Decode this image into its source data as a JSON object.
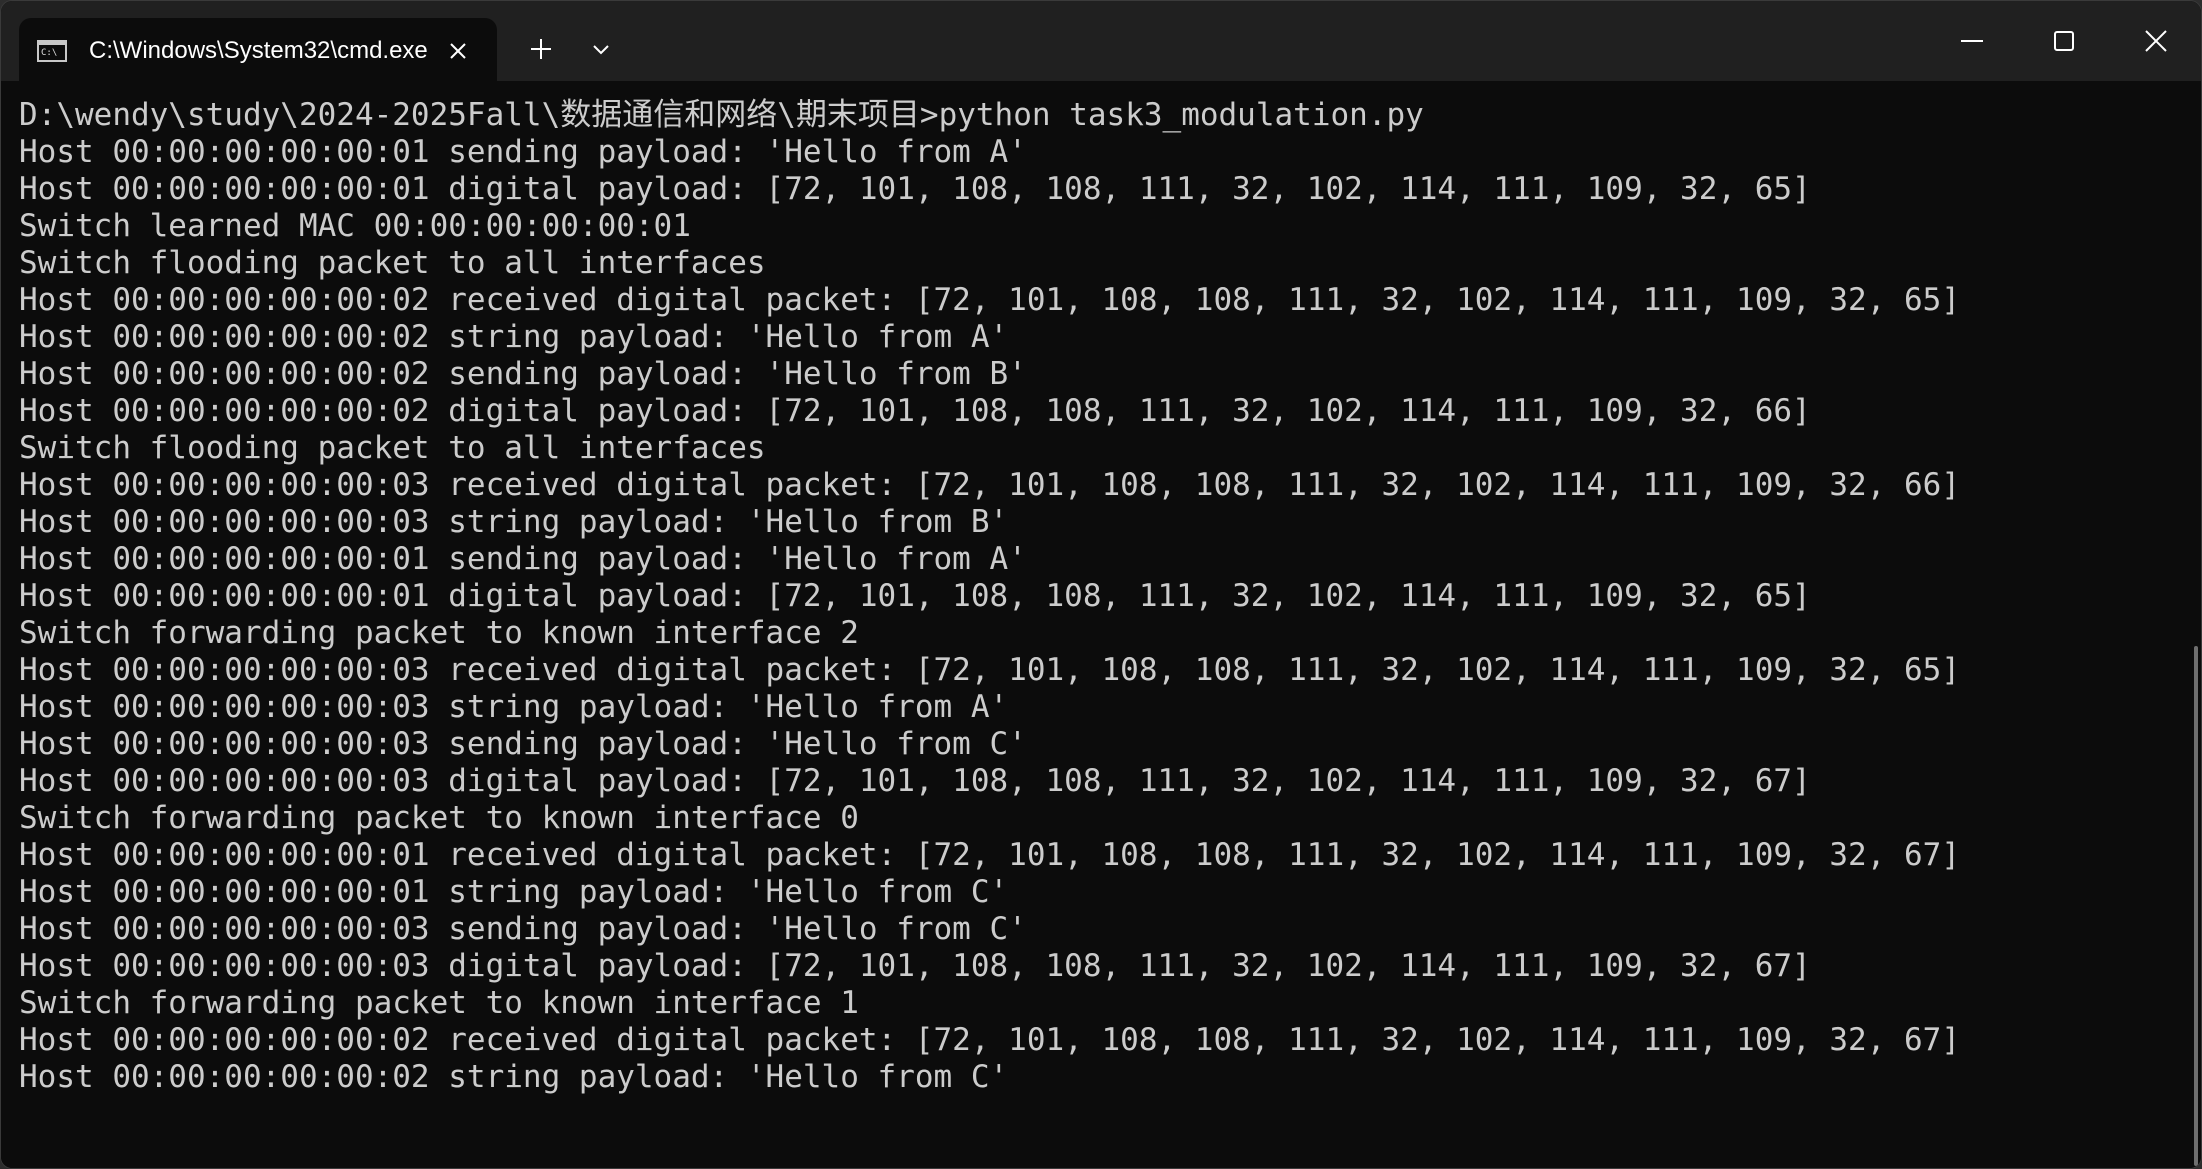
{
  "window": {
    "tab_title": "C:\\Windows\\System32\\cmd.exe",
    "tab_icon": "cmd-terminal-icon",
    "buttons": {
      "new_tab_icon": "plus-icon",
      "dropdown_icon": "chevron-down-icon",
      "minimize_icon": "minimize-icon",
      "maximize_icon": "maximize-icon",
      "close_icon": "close-icon"
    },
    "colors": {
      "titlebar": "#202020",
      "background": "#0c0c0c",
      "text": "#cccccc"
    }
  },
  "terminal": {
    "lines": [
      "D:\\wendy\\study\\2024-2025Fall\\数据通信和网络\\期末项目>python task3_modulation.py",
      "Host 00:00:00:00:00:01 sending payload: 'Hello from A'",
      "Host 00:00:00:00:00:01 digital payload: [72, 101, 108, 108, 111, 32, 102, 114, 111, 109, 32, 65]",
      "Switch learned MAC 00:00:00:00:00:01",
      "Switch flooding packet to all interfaces",
      "Host 00:00:00:00:00:02 received digital packet: [72, 101, 108, 108, 111, 32, 102, 114, 111, 109, 32, 65]",
      "Host 00:00:00:00:00:02 string payload: 'Hello from A'",
      "Host 00:00:00:00:00:02 sending payload: 'Hello from B'",
      "Host 00:00:00:00:00:02 digital payload: [72, 101, 108, 108, 111, 32, 102, 114, 111, 109, 32, 66]",
      "Switch flooding packet to all interfaces",
      "Host 00:00:00:00:00:03 received digital packet: [72, 101, 108, 108, 111, 32, 102, 114, 111, 109, 32, 66]",
      "Host 00:00:00:00:00:03 string payload: 'Hello from B'",
      "Host 00:00:00:00:00:01 sending payload: 'Hello from A'",
      "Host 00:00:00:00:00:01 digital payload: [72, 101, 108, 108, 111, 32, 102, 114, 111, 109, 32, 65]",
      "Switch forwarding packet to known interface 2",
      "Host 00:00:00:00:00:03 received digital packet: [72, 101, 108, 108, 111, 32, 102, 114, 111, 109, 32, 65]",
      "Host 00:00:00:00:00:03 string payload: 'Hello from A'",
      "Host 00:00:00:00:00:03 sending payload: 'Hello from C'",
      "Host 00:00:00:00:00:03 digital payload: [72, 101, 108, 108, 111, 32, 102, 114, 111, 109, 32, 67]",
      "Switch forwarding packet to known interface 0",
      "Host 00:00:00:00:00:01 received digital packet: [72, 101, 108, 108, 111, 32, 102, 114, 111, 109, 32, 67]",
      "Host 00:00:00:00:00:01 string payload: 'Hello from C'",
      "Host 00:00:00:00:00:03 sending payload: 'Hello from C'",
      "Host 00:00:00:00:00:03 digital payload: [72, 101, 108, 108, 111, 32, 102, 114, 111, 109, 32, 67]",
      "Switch forwarding packet to known interface 1",
      "Host 00:00:00:00:00:02 received digital packet: [72, 101, 108, 108, 111, 32, 102, 114, 111, 109, 32, 67]",
      "Host 00:00:00:00:00:02 string payload: 'Hello from C'"
    ]
  }
}
